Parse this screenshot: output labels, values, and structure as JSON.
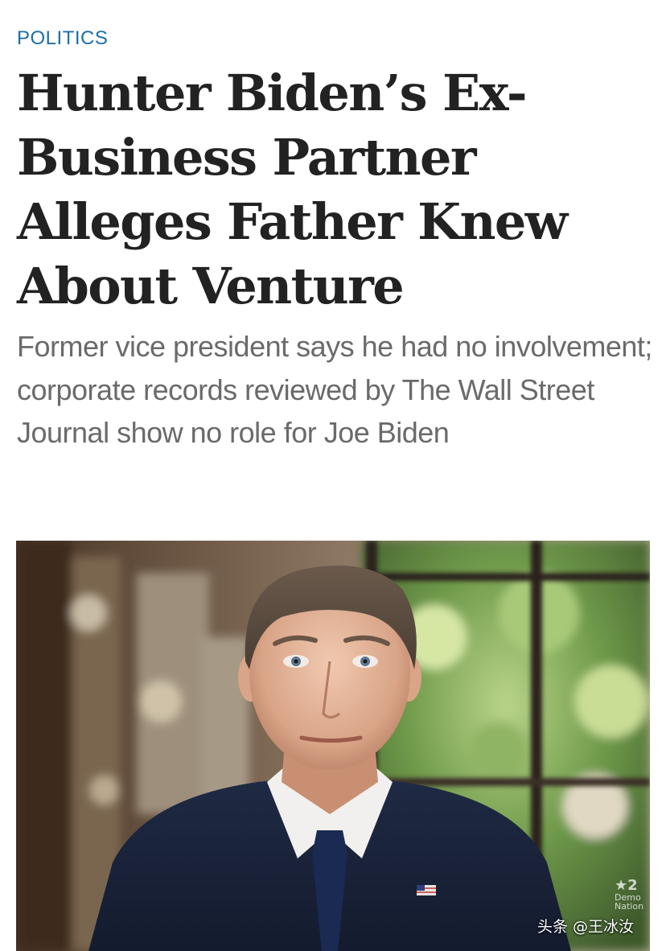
{
  "article": {
    "section": "POLITICS",
    "headline": "Hunter Biden’s Ex-Business Partner Alleges Father Knew About Venture",
    "dek": "Former vice president says he had no involvement; corporate records reviewed by The Wall Street Journal show no role for Joe Biden"
  },
  "photo": {
    "watermark": "头条 @王冰汝",
    "broadcast_logo_icon": "dnc-logo-icon"
  },
  "colors": {
    "section": "#1d6fa5",
    "headline": "#222222",
    "dek": "#6a6a6a",
    "background": "#ffffff"
  }
}
